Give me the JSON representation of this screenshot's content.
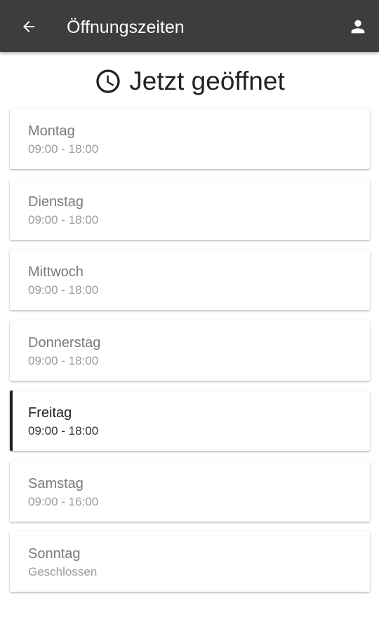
{
  "appbar": {
    "title": "Öffnungszeiten",
    "back_icon": "arrow-back-icon",
    "account_icon": "person-icon",
    "background": "#3d3d3d"
  },
  "status": {
    "icon": "clock-icon",
    "text": "Jetzt geöffnet"
  },
  "days": [
    {
      "name": "Montag",
      "hours": "09:00 - 18:00",
      "active": false
    },
    {
      "name": "Dienstag",
      "hours": "09:00 - 18:00",
      "active": false
    },
    {
      "name": "Mittwoch",
      "hours": "09:00 - 18:00",
      "active": false
    },
    {
      "name": "Donnerstag",
      "hours": "09:00 - 18:00",
      "active": false
    },
    {
      "name": "Freitag",
      "hours": "09:00 - 18:00",
      "active": true
    },
    {
      "name": "Samstag",
      "hours": "09:00 - 16:00",
      "active": false
    },
    {
      "name": "Sonntag",
      "hours": "Geschlossen",
      "active": false
    }
  ]
}
